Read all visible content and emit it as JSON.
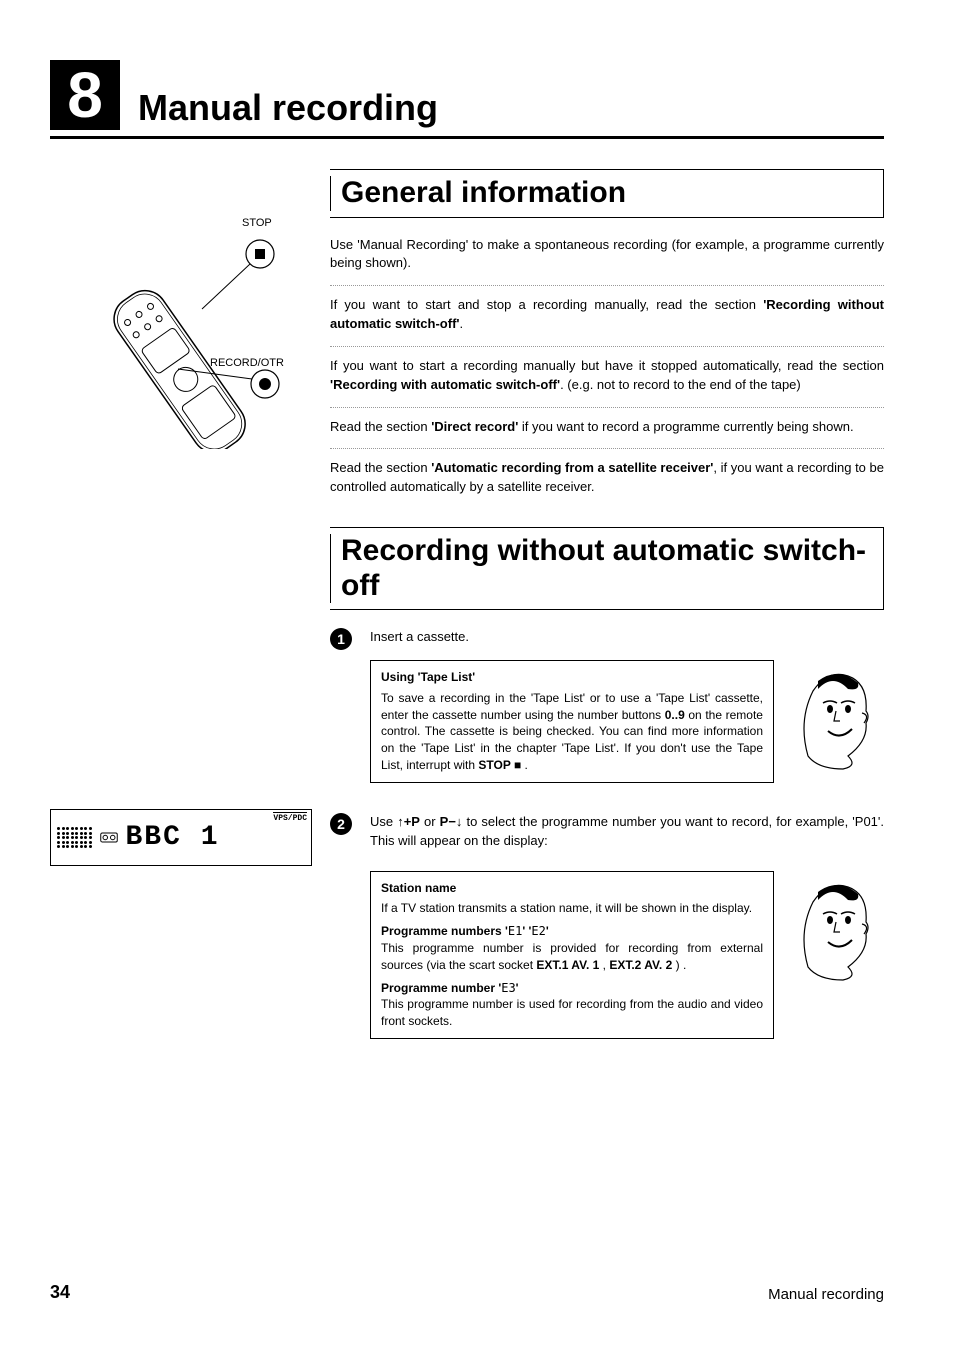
{
  "chapter": {
    "number": "8",
    "title": "Manual recording"
  },
  "remote": {
    "label_stop": "STOP",
    "label_record": "RECORD/OTR"
  },
  "section1": {
    "title": "General information",
    "p1": "Use 'Manual Recording' to make a spontaneous recording (for example, a programme currently being shown).",
    "p2a": "If you want to start and stop a recording manually, read the section ",
    "p2b": "'Recording without automatic switch-off'",
    "p2c": ".",
    "p3a": "If you want to start a recording manually but have it stopped automatically, read the section ",
    "p3b": "'Recording with automatic switch-off'",
    "p3c": ". (e.g. not to record to the end of the tape)",
    "p4a": "Read the section ",
    "p4b": "'Direct record'",
    "p4c": " if you want to record a programme currently being shown.",
    "p5a": "Read the section ",
    "p5b": "'Automatic recording from a satellite receiver'",
    "p5c": ", if you want a recording to be controlled automatically by a satellite receiver."
  },
  "section2": {
    "title": "Recording without automatic switch-off",
    "step1": "Insert a cassette.",
    "note1": {
      "title": "Using 'Tape List'",
      "t1": "To save a recording in the 'Tape List' or to use a 'Tape List' cassette, enter the cassette number using the number buttons ",
      "btn": "0..9",
      "t2": " on the remote control. The cassette is being checked. You can find more information on the 'Tape List' in the chapter 'Tape List'. If you don't use the Tape List, interrupt with ",
      "stop": "STOP ",
      "stop_glyph": "■",
      "t3": " ."
    },
    "step2a": "Use  ",
    "step2_btn1": "↑+P",
    "step2b": " or  ",
    "step2_btn2": "P−↓",
    "step2c": "  to select the programme number you want to record, for example, 'P01'. This will appear on the display:",
    "note2": {
      "h1": "Station name",
      "t1": "If a TV station transmits a station name, it will be shown in the display.",
      "h2a": "Programme numbers '",
      "e1": "E1",
      "h2b": "' '",
      "e2": "E2",
      "h2c": "'",
      "t2a": "This programme number is provided for recording from external sources (via the scart socket ",
      "ext1": "EXT.1  AV. 1",
      "t2b": " , ",
      "ext2": "EXT.2  AV. 2",
      "t2c": " ) .",
      "h3a": "Programme number '",
      "e3": "E3",
      "h3b": "'",
      "t3": "This programme number is used for recording from the audio and video front sockets."
    }
  },
  "display": {
    "digits": "BBC  1",
    "vpspdc": "VPS/PDC"
  },
  "footer": {
    "page": "34",
    "label": "Manual recording"
  }
}
